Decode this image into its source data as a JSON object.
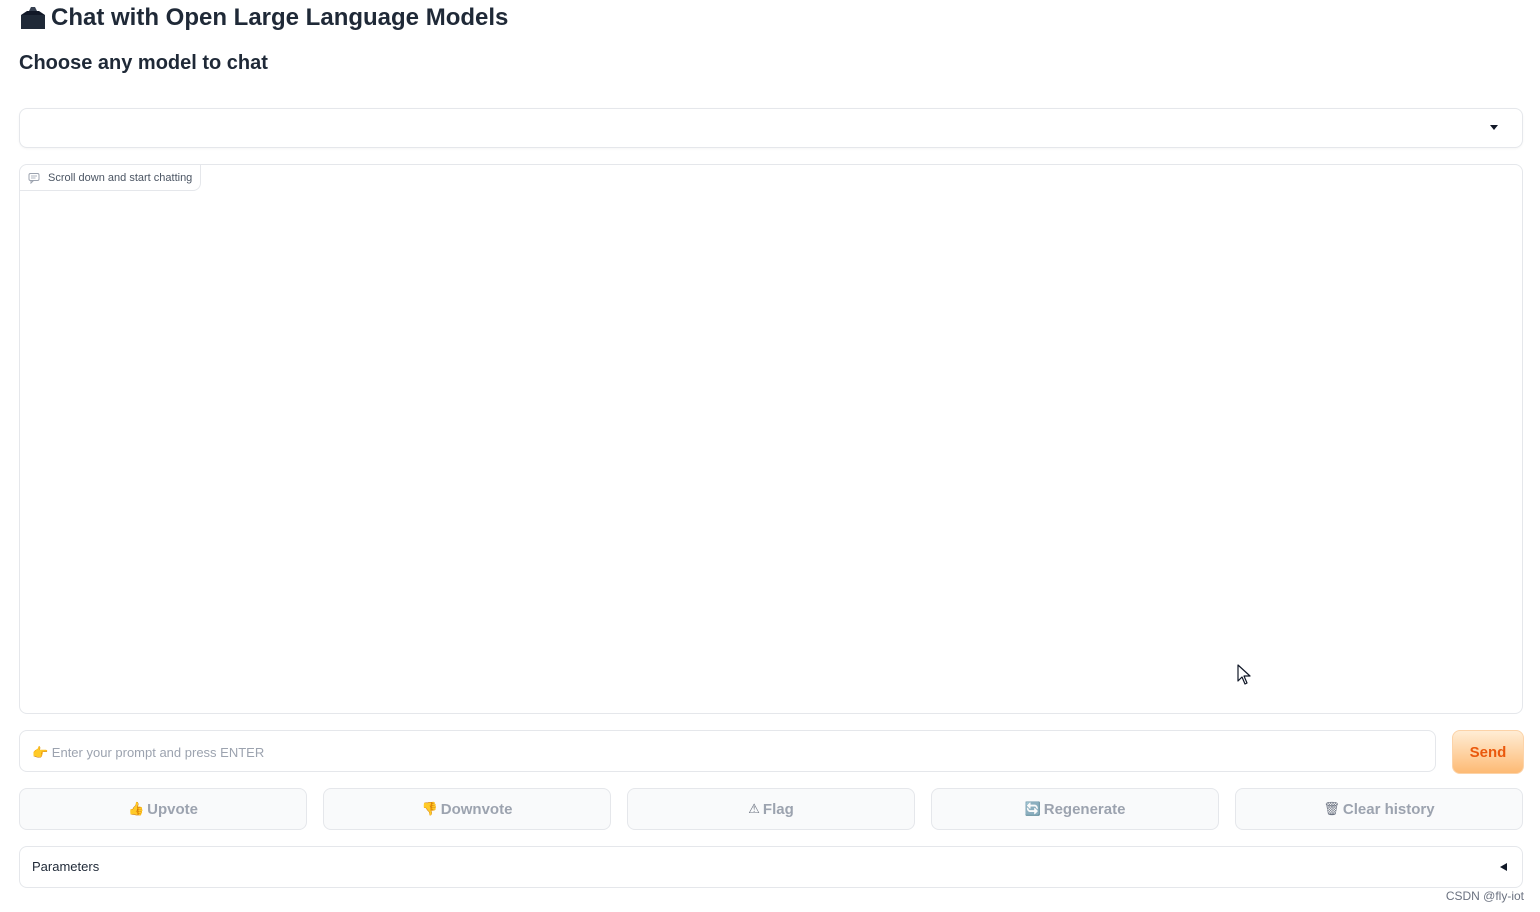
{
  "header": {
    "title": "Chat with Open Large Language Models",
    "title_icon": "briefcase-icon",
    "subtitle": "Choose any model to chat"
  },
  "model_selector": {
    "selected": ""
  },
  "chatbot": {
    "label": "Scroll down and start chatting",
    "label_icon": "chat-icon"
  },
  "prompt": {
    "value": "",
    "placeholder": "👉 Enter your prompt and press ENTER"
  },
  "send_button": {
    "label": "Send"
  },
  "actions": {
    "upvote": {
      "icon": "👍",
      "label": "Upvote"
    },
    "downvote": {
      "icon": "👎",
      "label": "Downvote"
    },
    "flag": {
      "icon": "⚠",
      "label": "Flag"
    },
    "regenerate": {
      "icon": "🔄",
      "label": "Regenerate"
    },
    "clear": {
      "icon": "🗑",
      "label": "Clear history"
    }
  },
  "parameters": {
    "label": "Parameters"
  },
  "watermark": "CSDN @fly-iot",
  "colors": {
    "send_text": "#ea580c",
    "send_bg_top": "#ffedd5",
    "send_bg_bottom": "#fdba74",
    "disabled_text": "#9ca3af",
    "border": "#e5e7eb"
  }
}
